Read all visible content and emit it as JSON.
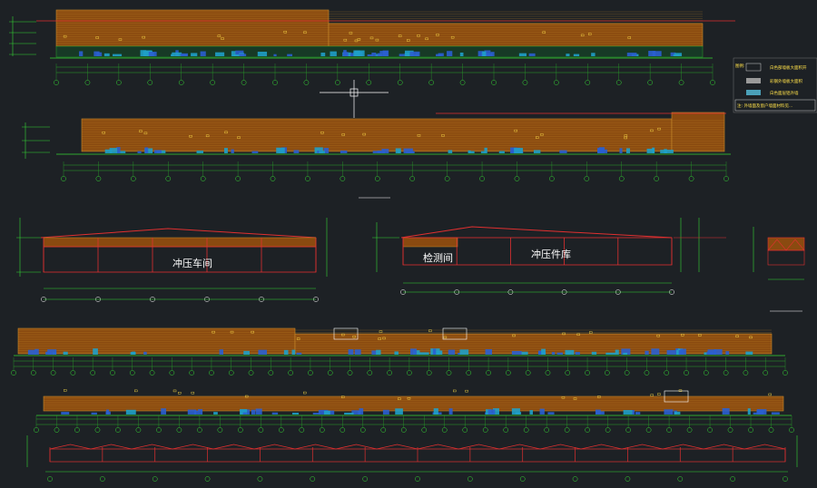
{
  "drawing": {
    "background": "#1d2125",
    "colors": {
      "grid_green": "#2aa52a",
      "bright_green": "#35d535",
      "roof_orange": "#a05a12",
      "roof_line": "#c88a2a",
      "frame_red": "#e03030",
      "cyan": "#1fa0c8",
      "blue_equipment": "#2a5fd0",
      "white": "#ffffff",
      "yellow": "#ffe14a"
    }
  },
  "labels": {
    "stamping_workshop": "冲压车间",
    "inspection_room": "检测间",
    "stamping_parts_store": "冲压件库"
  },
  "legend": {
    "title": "图例:",
    "items": [
      "白色部墙板大面积开",
      "彩钢外墙板大面积",
      "白色面层铝外墙"
    ],
    "note": "注: 外墙面及窗户墙面材料见..."
  }
}
